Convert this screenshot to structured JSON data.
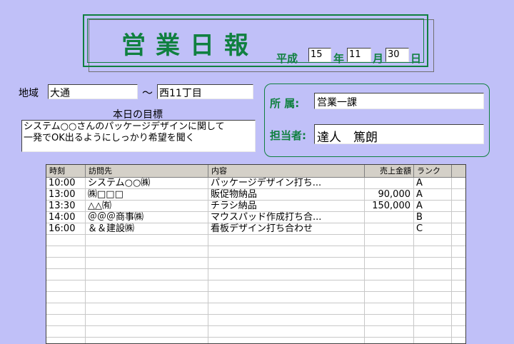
{
  "title": "営業日報",
  "date": {
    "era_label": "平成",
    "year": "15",
    "year_label": "年",
    "month": "11",
    "month_label": "月",
    "day": "30",
    "day_label": "日"
  },
  "area": {
    "label": "地域",
    "from": "大通",
    "separator": "～",
    "to": "西11丁目"
  },
  "goal": {
    "label": "本日の目標",
    "text_line1": "システム○○さんのパッケージデザインに関して",
    "text_line2": "一発でOK出るようにしっかり希望を聞く"
  },
  "department": {
    "label": "所 属:",
    "value": "営業一課"
  },
  "staff": {
    "label": "担当者:",
    "value": "達人　篤朗"
  },
  "table": {
    "headers": [
      "時刻",
      "訪問先",
      "内容",
      "売上金額",
      "ランク"
    ],
    "rows": [
      [
        "10:00",
        "システム○○㈱",
        "パッケージデザイン打ち...",
        "",
        "A"
      ],
      [
        "13:00",
        "㈱□□□",
        "販促物納品",
        "90,000",
        "A"
      ],
      [
        "13:30",
        "△△㈲",
        "チラシ納品",
        "150,000",
        "A"
      ],
      [
        "14:00",
        "＠＠＠商事㈱",
        "マウスパッド作成打ち合...",
        "",
        "B"
      ],
      [
        "16:00",
        "＆＆建設㈱",
        "看板デザイン打ち合わせ",
        "",
        "C"
      ],
      [
        "",
        "",
        "",
        "",
        ""
      ],
      [
        "",
        "",
        "",
        "",
        ""
      ],
      [
        "",
        "",
        "",
        "",
        ""
      ],
      [
        "",
        "",
        "",
        "",
        ""
      ],
      [
        "",
        "",
        "",
        "",
        ""
      ],
      [
        "",
        "",
        "",
        "",
        ""
      ],
      [
        "",
        "",
        "",
        "",
        ""
      ],
      [
        "",
        "",
        "",
        "",
        ""
      ],
      [
        "",
        "",
        "",
        "",
        ""
      ],
      [
        "",
        "",
        "",
        "",
        ""
      ]
    ]
  },
  "colors": {
    "background": "#c0c0f8",
    "accent_green": "#108040"
  }
}
